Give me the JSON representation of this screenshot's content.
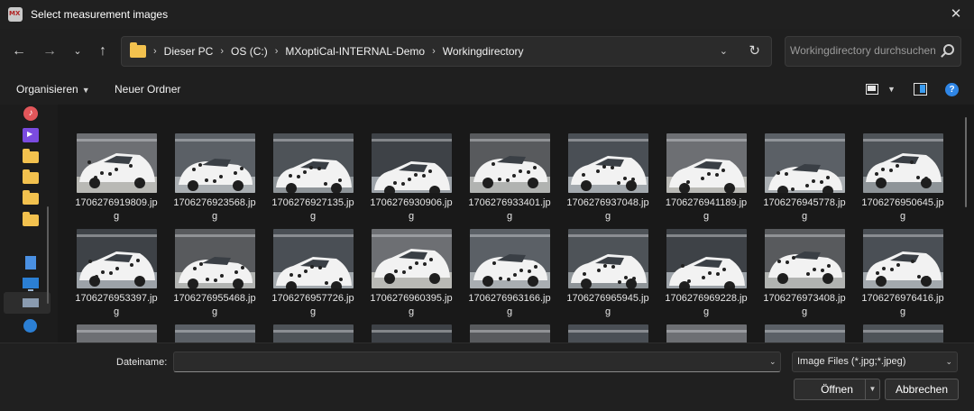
{
  "window": {
    "title": "Select measurement images"
  },
  "address": {
    "crumbs": [
      "Dieser PC",
      "OS (C:)",
      "MXoptiCal-INTERNAL-Demo",
      "Workingdirectory"
    ]
  },
  "search": {
    "placeholder": "Workingdirectory durchsuchen"
  },
  "toolbar": {
    "organize_label": "Organisieren",
    "new_folder_label": "Neuer Ordner"
  },
  "files": [
    {
      "line1": "1706276919809.jp",
      "line2": "g"
    },
    {
      "line1": "1706276923568.jp",
      "line2": "g"
    },
    {
      "line1": "1706276927135.jp",
      "line2": "g"
    },
    {
      "line1": "1706276930906.jp",
      "line2": "g"
    },
    {
      "line1": "1706276933401.jp",
      "line2": "g"
    },
    {
      "line1": "1706276937048.jp",
      "line2": "g"
    },
    {
      "line1": "1706276941189.jp",
      "line2": "g"
    },
    {
      "line1": "1706276945778.jp",
      "line2": "g"
    },
    {
      "line1": "1706276950645.jp",
      "line2": "g"
    },
    {
      "line1": "1706276953397.jp",
      "line2": "g"
    },
    {
      "line1": "1706276955468.jp",
      "line2": "g"
    },
    {
      "line1": "1706276957726.jp",
      "line2": "g"
    },
    {
      "line1": "1706276960395.jp",
      "line2": "g"
    },
    {
      "line1": "1706276963166.jp",
      "line2": "g"
    },
    {
      "line1": "1706276965945.jp",
      "line2": "g"
    },
    {
      "line1": "1706276969228.jp",
      "line2": "g"
    },
    {
      "line1": "1706276973408.jp",
      "line2": "g"
    },
    {
      "line1": "1706276976416.jp",
      "line2": "g"
    }
  ],
  "footer": {
    "filename_label": "Dateiname:",
    "filename_value": "",
    "filter_label": "Image Files (*.jpg;*.jpeg)",
    "open_label": "Öffnen",
    "cancel_label": "Abbrechen"
  }
}
